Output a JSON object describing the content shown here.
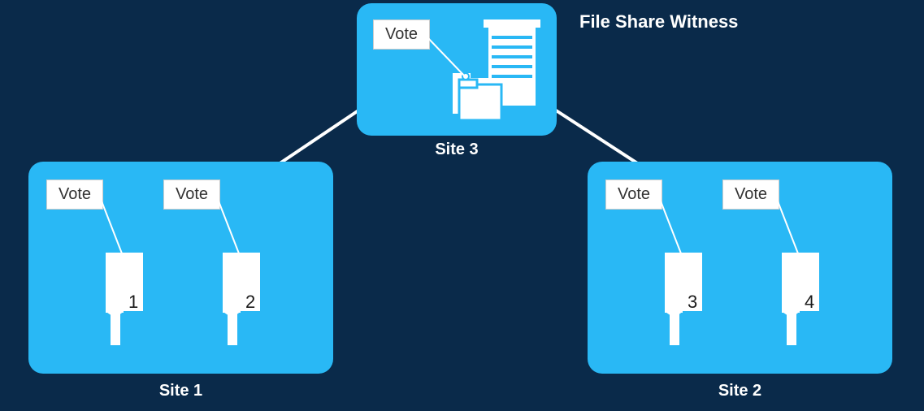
{
  "title": "File Share Witness",
  "sites": {
    "site3": {
      "label": "Site 3",
      "vote": "Vote"
    },
    "site1": {
      "label": "Site 1",
      "votes": [
        "Vote",
        "Vote"
      ],
      "nodes": [
        "1",
        "2"
      ]
    },
    "site2": {
      "label": "Site 2",
      "votes": [
        "Vote",
        "Vote"
      ],
      "nodes": [
        "3",
        "4"
      ]
    }
  },
  "chart_data": {
    "type": "diagram",
    "description": "Cluster quorum with file share witness at a third site",
    "witness": {
      "site": "Site 3",
      "type": "File Share Witness",
      "has_vote": true
    },
    "nodes": [
      {
        "id": 1,
        "site": "Site 1",
        "has_vote": true
      },
      {
        "id": 2,
        "site": "Site 1",
        "has_vote": true
      },
      {
        "id": 3,
        "site": "Site 2",
        "has_vote": true
      },
      {
        "id": 4,
        "site": "Site 2",
        "has_vote": true
      }
    ],
    "connections": [
      {
        "from": "Site 3",
        "to": "Site 1"
      },
      {
        "from": "Site 3",
        "to": "Site 2"
      }
    ],
    "total_votes": 5
  },
  "colors": {
    "background": "#0a2a4a",
    "panel": "#29b8f5",
    "text_light": "#ffffff",
    "text_dark": "#333333",
    "vote_bg": "#ffffff"
  }
}
